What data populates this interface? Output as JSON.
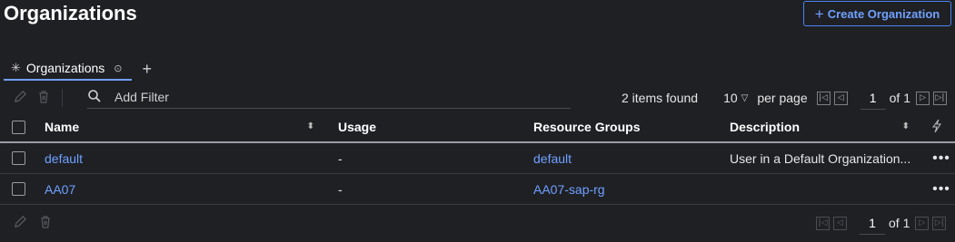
{
  "page": {
    "title": "Organizations"
  },
  "header": {
    "create_button_label": "Create Organization"
  },
  "tabs": [
    {
      "label": "Organizations"
    }
  ],
  "toolbar": {
    "filter_placeholder": "Add Filter",
    "items_found": "2 items found",
    "per_page_value": "10",
    "per_page_label": "per page",
    "page_number": "1",
    "of_pages": "of 1"
  },
  "table": {
    "columns": [
      {
        "label": "Name"
      },
      {
        "label": "Usage"
      },
      {
        "label": "Resource Groups"
      },
      {
        "label": "Description"
      }
    ],
    "rows": [
      {
        "name": "default",
        "usage": "-",
        "resource_groups": "default",
        "description": "User in a Default Organization..."
      },
      {
        "name": "AA07",
        "usage": "-",
        "resource_groups": "AA07-sap-rg",
        "description": ""
      }
    ]
  },
  "footer": {
    "page_number": "1",
    "of_pages": "of 1"
  },
  "icons": {
    "tab_icon": "asterisk-icon",
    "pin_icon": "pin-icon",
    "add_tab": "plus-icon",
    "edit": "pencil-icon",
    "delete": "trash-icon",
    "search": "search-icon",
    "row_actions": "more-horizontal-icon",
    "column_actions": "lightning-icon"
  },
  "colors": {
    "background": "#1f2024",
    "accent": "#6fa0ff",
    "button_border": "#4a84f0"
  }
}
